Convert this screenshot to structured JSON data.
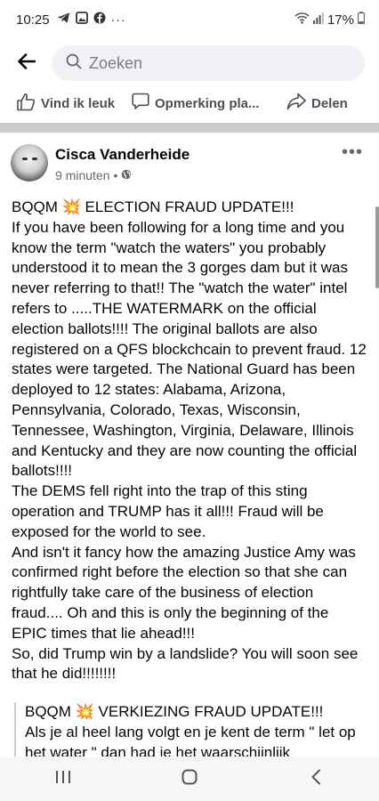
{
  "status": {
    "time": "10:25",
    "battery": "17%",
    "icons": [
      "telegram-icon",
      "gallery-icon",
      "facebook-icon",
      "more-dots-icon",
      "wifi-icon",
      "signal-icon",
      "battery-icon"
    ]
  },
  "search": {
    "placeholder": "Zoeken"
  },
  "actions": {
    "like": "Vind ik leuk",
    "comment": "Opmerking pla...",
    "share": "Delen"
  },
  "post": {
    "author": "Cisca Vanderheide",
    "time": "9 minuten",
    "more": "•••",
    "paragraphs": [
      "BQQM 💥 ELECTION FRAUD UPDATE!!!",
      "If you have been following for a long time and you know the term \"watch the waters\" you probably understood it to mean the 3 gorges dam but it was never referring to that!! The \"watch the water\" intel refers to .....THE WATERMARK on the official election ballots!!!! The original ballots are also registered on a QFS blockchcain to prevent fraud. 12 states were targeted. The National Guard has been deployed to 12 states: Alabama, Arizona, Pennsylvania, Colorado, Texas, Wisconsin, Tennessee, Washington, Virginia, Delaware, Illinois and Kentucky and they are now counting the official ballots!!!!",
      "The DEMS fell right into the trap of this sting operation and TRUMP has it all!!! Fraud will be exposed for the world to see.",
      "And isn't it fancy how the amazing Justice Amy was confirmed right before the election so that she can rightfully take care of the business of election fraud.... Oh and this is only the beginning of the EPIC times that lie ahead!!!",
      "So, did Trump win by a landslide? You will soon see that he did!!!!!!!!"
    ],
    "quote": {
      "line1": "BQQM 💥 VERKIEZING FRAUD UPDATE!!!",
      "line2": "Als je al heel lang volgt en je kent de term \" let op het water \" dan had je het waarschijnlijk"
    }
  },
  "colors": {
    "text": "#050505",
    "secondary": "#65676b",
    "divider": "#c9ccd1",
    "search_bg": "#f0f2f5"
  }
}
